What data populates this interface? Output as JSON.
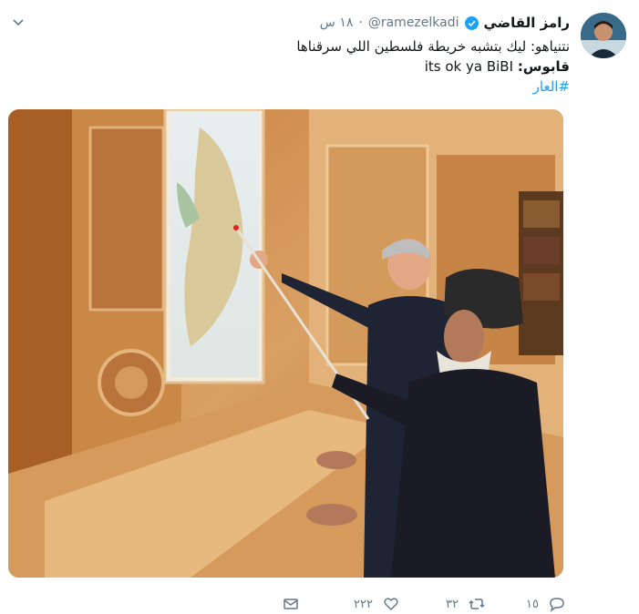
{
  "author": {
    "name": "رامز القاضي",
    "handle": "@ramezelkadi",
    "separator": "·",
    "time": "١٨ س",
    "avatar_icon": "user-avatar"
  },
  "tweet": {
    "line1": "نتنياهو: ليك بتشبه خريطة فلسطين اللي سرقناها",
    "line2_prefix": "قابوس:",
    "line2_text": " its ok ya BiBI",
    "hashtag": "#العار"
  },
  "actions": {
    "reply_count": "١٥",
    "retweet_count": "٣٢",
    "like_count": "٢٢٢"
  },
  "colors": {
    "accent": "#1da1f2",
    "muted": "#657786",
    "text": "#14171a"
  }
}
